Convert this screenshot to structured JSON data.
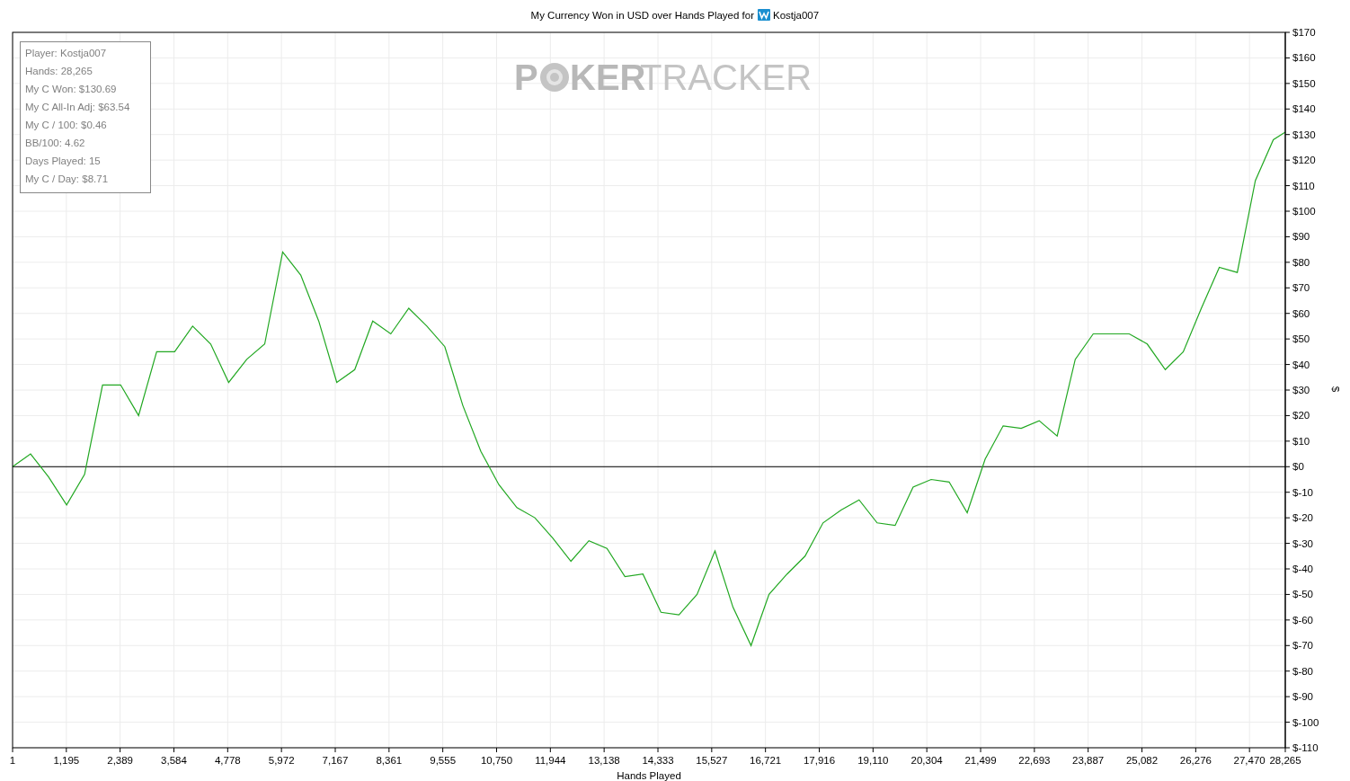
{
  "header": {
    "text": "My Currency Won in USD over Hands Played for",
    "player": "Kostja007"
  },
  "stats": [
    "Player: Kostja007",
    "Hands: 28,265",
    "My C Won: $130.69",
    "My C All-In Adj: $63.54",
    "My C / 100: $0.46",
    "BB/100: 4.62",
    "Days Played: 15",
    "My C / Day: $8.71"
  ],
  "watermark": {
    "lead": "P",
    "bold": "KER",
    "light": "TRACKER"
  },
  "chart_data": {
    "type": "line",
    "xlabel": "Hands Played",
    "ylabel": "$",
    "x": [
      1,
      400,
      800,
      1200,
      1600,
      2000,
      2400,
      2800,
      3200,
      3600,
      4000,
      4400,
      4800,
      5200,
      5600,
      6000,
      6400,
      6800,
      7200,
      7600,
      8000,
      8400,
      8800,
      9200,
      9600,
      10000,
      10400,
      10800,
      11200,
      11600,
      12000,
      12400,
      12800,
      13200,
      13600,
      14000,
      14400,
      14800,
      15200,
      15600,
      16000,
      16400,
      16800,
      17200,
      17600,
      18000,
      18400,
      18800,
      19200,
      19600,
      20000,
      20400,
      20800,
      21200,
      21600,
      22000,
      22400,
      22800,
      23200,
      23600,
      24000,
      24400,
      24800,
      25200,
      25600,
      26000,
      26400,
      26800,
      27200,
      27600,
      28000,
      28265
    ],
    "series": [
      {
        "color": "#22a822",
        "values": [
          0,
          5,
          -4,
          -15,
          -3,
          32,
          32,
          20,
          45,
          45,
          55,
          48,
          33,
          42,
          48,
          84,
          75,
          57,
          33,
          38,
          57,
          52,
          62,
          55,
          47,
          24,
          6,
          -7,
          -16,
          -20,
          -28,
          -37,
          -29,
          -32,
          -43,
          -42,
          -57,
          -58,
          -50,
          -33,
          -55,
          -70,
          -50,
          -42,
          -35,
          -22,
          -17,
          -13,
          -22,
          -23,
          -8,
          -5,
          -6,
          -18,
          3,
          16,
          15,
          18,
          12,
          42,
          52,
          52,
          52,
          48,
          38,
          45,
          62,
          78,
          76,
          112,
          128,
          131
        ]
      }
    ],
    "grid": true,
    "xlim": [
      1,
      28265
    ],
    "ylim": [
      -110,
      170
    ],
    "xticks": [
      {
        "value": 1,
        "label": "1"
      },
      {
        "value": 1195,
        "label": "1,195"
      },
      {
        "value": 2389,
        "label": "2,389"
      },
      {
        "value": 3584,
        "label": "3,584"
      },
      {
        "value": 4778,
        "label": "4,778"
      },
      {
        "value": 5972,
        "label": "5,972"
      },
      {
        "value": 7167,
        "label": "7,167"
      },
      {
        "value": 8361,
        "label": "8,361"
      },
      {
        "value": 9555,
        "label": "9,555"
      },
      {
        "value": 10750,
        "label": "10,750"
      },
      {
        "value": 11944,
        "label": "11,944"
      },
      {
        "value": 13138,
        "label": "13,138"
      },
      {
        "value": 14333,
        "label": "14,333"
      },
      {
        "value": 15527,
        "label": "15,527"
      },
      {
        "value": 16721,
        "label": "16,721"
      },
      {
        "value": 17916,
        "label": "17,916"
      },
      {
        "value": 19110,
        "label": "19,110"
      },
      {
        "value": 20304,
        "label": "20,304"
      },
      {
        "value": 21499,
        "label": "21,499"
      },
      {
        "value": 22693,
        "label": "22,693"
      },
      {
        "value": 23887,
        "label": "23,887"
      },
      {
        "value": 25082,
        "label": "25,082"
      },
      {
        "value": 26276,
        "label": "26,276"
      },
      {
        "value": 27470,
        "label": "27,470"
      },
      {
        "value": 28265,
        "label": "28,265"
      }
    ],
    "yticks": [
      {
        "value": 170,
        "label": "$170"
      },
      {
        "value": 160,
        "label": "$160"
      },
      {
        "value": 150,
        "label": "$150"
      },
      {
        "value": 140,
        "label": "$140"
      },
      {
        "value": 130,
        "label": "$130"
      },
      {
        "value": 120,
        "label": "$120"
      },
      {
        "value": 110,
        "label": "$110"
      },
      {
        "value": 100,
        "label": "$100"
      },
      {
        "value": 90,
        "label": "$90"
      },
      {
        "value": 80,
        "label": "$80"
      },
      {
        "value": 70,
        "label": "$70"
      },
      {
        "value": 60,
        "label": "$60"
      },
      {
        "value": 50,
        "label": "$50"
      },
      {
        "value": 40,
        "label": "$40"
      },
      {
        "value": 30,
        "label": "$30"
      },
      {
        "value": 20,
        "label": "$20"
      },
      {
        "value": 10,
        "label": "$10"
      },
      {
        "value": 0,
        "label": "$0"
      },
      {
        "value": -10,
        "label": "$-10"
      },
      {
        "value": -20,
        "label": "$-20"
      },
      {
        "value": -30,
        "label": "$-30"
      },
      {
        "value": -40,
        "label": "$-40"
      },
      {
        "value": -50,
        "label": "$-50"
      },
      {
        "value": -60,
        "label": "$-60"
      },
      {
        "value": -70,
        "label": "$-70"
      },
      {
        "value": -80,
        "label": "$-80"
      },
      {
        "value": -90,
        "label": "$-90"
      },
      {
        "value": -100,
        "label": "$-100"
      },
      {
        "value": -110,
        "label": "$-110"
      }
    ]
  }
}
